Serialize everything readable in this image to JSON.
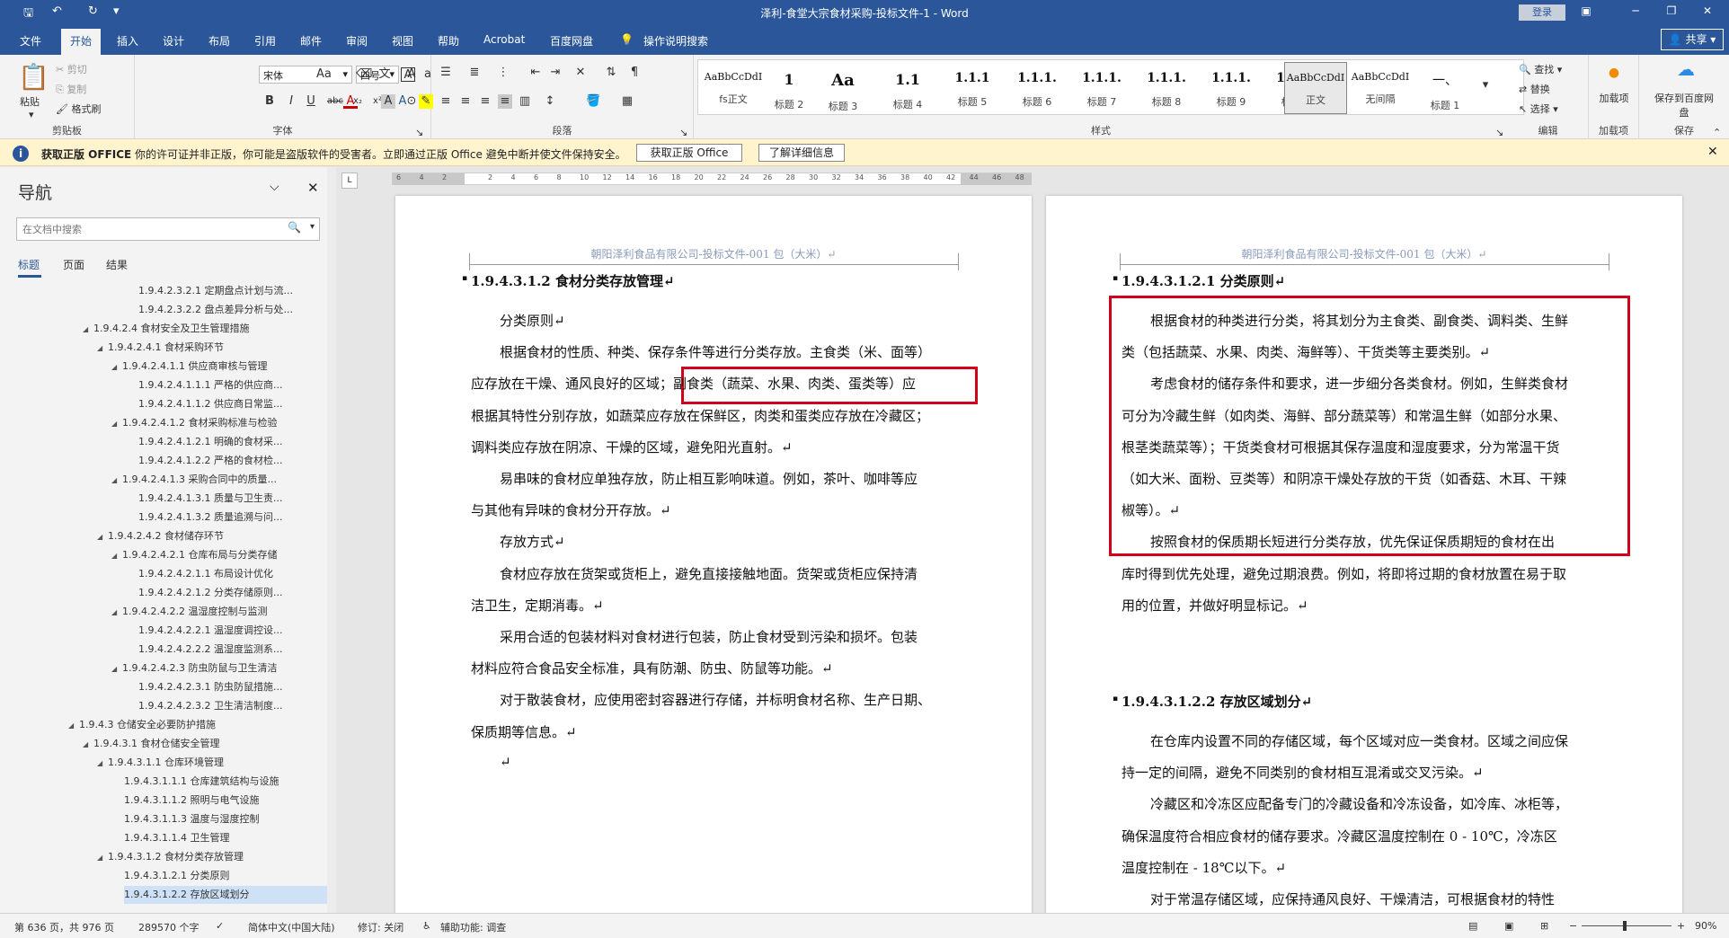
{
  "app": {
    "window_title": "泽利-食堂大宗食材采购-投标文件-1  -  Word",
    "login_label": "登录",
    "share_label": "共享"
  },
  "menu": [
    "文件",
    "开始",
    "插入",
    "设计",
    "布局",
    "引用",
    "邮件",
    "审阅",
    "视图",
    "帮助",
    "Acrobat",
    "百度网盘",
    "操作说明搜索"
  ],
  "ribbon": {
    "clipboard": {
      "label": "剪贴板",
      "paste": "粘贴",
      "cut": "剪切",
      "copy": "复制",
      "painter": "格式刷"
    },
    "font": {
      "label": "字体",
      "family": "宋体",
      "size": "四号"
    },
    "paragraph": {
      "label": "段落"
    },
    "styles": {
      "label": "样式",
      "items": [
        {
          "preview": "AaBbCcDdI",
          "name": "fs正文"
        },
        {
          "preview": "1",
          "name": "标题 2"
        },
        {
          "preview": "Aa",
          "name": "标题 3"
        },
        {
          "preview": "1.1",
          "name": "标题 4"
        },
        {
          "preview": "1.1.1",
          "name": "标题 5"
        },
        {
          "preview": "1.1.1.",
          "name": "标题 6"
        },
        {
          "preview": "1.1.1.",
          "name": "标题 7"
        },
        {
          "preview": "1.1.1.",
          "name": "标题 8"
        },
        {
          "preview": "1.1.1.",
          "name": "标题 9"
        },
        {
          "preview": "1.1.1.",
          "name": "标题 1"
        },
        {
          "preview": "AaBbCcDdI",
          "name": "正文"
        },
        {
          "preview": "AaBbCcDdI",
          "name": "无间隔"
        },
        {
          "preview": "一、",
          "name": "标题 1"
        }
      ]
    },
    "editing": {
      "label": "编辑",
      "find": "查找",
      "replace": "替换",
      "select": "选择"
    },
    "addins": {
      "label": "加载项",
      "load": "加载项"
    },
    "save": {
      "label": "保存",
      "save_to": "保存到百度网盘"
    }
  },
  "message_bar": {
    "title": "获取正版 OFFICE",
    "text": "你的许可证并非正版，你可能是盗版软件的受害者。立即通过正版 Office 避免中断并使文件保持安全。",
    "btn_get": "获取正版 Office",
    "btn_more": "了解详细信息"
  },
  "navigation": {
    "title": "导航",
    "search_placeholder": "在文档中搜索",
    "tabs": [
      "标题",
      "页面",
      "结果"
    ],
    "items": [
      {
        "t": "1.9.4.2.3.2.1 定期盘点计划与流...",
        "lvl": 8,
        "e": false
      },
      {
        "t": "1.9.4.2.3.2.2 盘点差异分析与处...",
        "lvl": 8,
        "e": false
      },
      {
        "t": "1.9.4.2.4 食材安全及卫生管理措施",
        "lvl": 5,
        "e": true
      },
      {
        "t": "1.9.4.2.4.1 食材采购环节",
        "lvl": 6,
        "e": true
      },
      {
        "t": "1.9.4.2.4.1.1 供应商审核与管理",
        "lvl": 7,
        "e": true
      },
      {
        "t": "1.9.4.2.4.1.1.1 严格的供应商...",
        "lvl": 8,
        "e": false
      },
      {
        "t": "1.9.4.2.4.1.1.2 供应商日常监...",
        "lvl": 8,
        "e": false
      },
      {
        "t": "1.9.4.2.4.1.2 食材采购标准与检验",
        "lvl": 7,
        "e": true
      },
      {
        "t": "1.9.4.2.4.1.2.1 明确的食材采...",
        "lvl": 8,
        "e": false
      },
      {
        "t": "1.9.4.2.4.1.2.2 严格的食材检...",
        "lvl": 8,
        "e": false
      },
      {
        "t": "1.9.4.2.4.1.3 采购合同中的质量...",
        "lvl": 7,
        "e": true
      },
      {
        "t": "1.9.4.2.4.1.3.1 质量与卫生责...",
        "lvl": 8,
        "e": false
      },
      {
        "t": "1.9.4.2.4.1.3.2 质量追溯与问...",
        "lvl": 8,
        "e": false
      },
      {
        "t": "1.9.4.2.4.2 食材储存环节",
        "lvl": 6,
        "e": true
      },
      {
        "t": "1.9.4.2.4.2.1 仓库布局与分类存储",
        "lvl": 7,
        "e": true
      },
      {
        "t": "1.9.4.2.4.2.1.1 布局设计优化",
        "lvl": 8,
        "e": false
      },
      {
        "t": "1.9.4.2.4.2.1.2 分类存储原则...",
        "lvl": 8,
        "e": false
      },
      {
        "t": "1.9.4.2.4.2.2 温湿度控制与监测",
        "lvl": 7,
        "e": true
      },
      {
        "t": "1.9.4.2.4.2.2.1 温湿度调控设...",
        "lvl": 8,
        "e": false
      },
      {
        "t": "1.9.4.2.4.2.2.2 温湿度监测系...",
        "lvl": 8,
        "e": false
      },
      {
        "t": "1.9.4.2.4.2.3 防虫防鼠与卫生清洁",
        "lvl": 7,
        "e": true
      },
      {
        "t": "1.9.4.2.4.2.3.1 防虫防鼠措施...",
        "lvl": 8,
        "e": false
      },
      {
        "t": "1.9.4.2.4.2.3.2 卫生清洁制度...",
        "lvl": 8,
        "e": false
      },
      {
        "t": "1.9.4.3 仓储安全必要防护措施",
        "lvl": 4,
        "e": true
      },
      {
        "t": "1.9.4.3.1 食材仓储安全管理",
        "lvl": 5,
        "e": true
      },
      {
        "t": "1.9.4.3.1.1 仓库环境管理",
        "lvl": 6,
        "e": true
      },
      {
        "t": "1.9.4.3.1.1.1 仓库建筑结构与设施",
        "lvl": 7,
        "e": false
      },
      {
        "t": "1.9.4.3.1.1.2 照明与电气设施",
        "lvl": 7,
        "e": false
      },
      {
        "t": "1.9.4.3.1.1.3 温度与湿度控制",
        "lvl": 7,
        "e": false
      },
      {
        "t": "1.9.4.3.1.1.4 卫生管理",
        "lvl": 7,
        "e": false
      },
      {
        "t": "1.9.4.3.1.2 食材分类存放管理",
        "lvl": 6,
        "e": true
      },
      {
        "t": "1.9.4.3.1.2.1 分类原则",
        "lvl": 7,
        "e": false
      },
      {
        "t": "1.9.4.3.1.2.2 存放区域划分",
        "lvl": 7,
        "e": false,
        "sel": true
      }
    ]
  },
  "ruler": {
    "ticks": [
      "6",
      "4",
      "2",
      "",
      "2",
      "4",
      "6",
      "8",
      "10",
      "12",
      "14",
      "16",
      "18",
      "20",
      "22",
      "24",
      "26",
      "28",
      "30",
      "32",
      "34",
      "36",
      "38",
      "40",
      "42",
      "44",
      "46",
      "48"
    ]
  },
  "page_left": {
    "header": "朝阳泽利食品有限公司-投标文件-001 包（大米）↵",
    "heading": "1.9.4.3.1.2 食材分类存放管理↵",
    "lines": [
      "分类原则↵",
      "根据食材的性质、种类、保存条件等进行分类存放。主食类（米、面等）",
      "应存放在干燥、通风良好的区域；副食类（蔬菜、水果、肉类、蛋类等）应",
      "根据其特性分别存放，如蔬菜应存放在保鲜区，肉类和蛋类应存放在冷藏区；",
      "调料类应存放在阴凉、干燥的区域，避免阳光直射。↵",
      "易串味的食材应单独存放，防止相互影响味道。例如，茶叶、咖啡等应",
      "与其他有异味的食材分开存放。↵",
      "存放方式↵",
      "食材应存放在货架或货柜上，避免直接接触地面。货架或货柜应保持清",
      "洁卫生，定期消毒。↵",
      "采用合适的包装材料对食材进行包装，防止食材受到污染和损坏。包装",
      "材料应符合食品安全标准，具有防潮、防虫、防鼠等功能。↵",
      "对于散装食材，应使用密封容器进行存储，并标明食材名称、生产日期、",
      "保质期等信息。↵",
      "↵"
    ]
  },
  "page_right": {
    "header": "朝阳泽利食品有限公司-投标文件-001 包（大米）↵",
    "heading1": "1.9.4.3.1.2.1  分类原则↵",
    "lines1": [
      "根据食材的种类进行分类，将其划分为主食类、副食类、调料类、生鲜",
      "类（包括蔬菜、水果、肉类、海鲜等）、干货类等主要类别。↵",
      "考虑食材的储存条件和要求，进一步细分各类食材。例如，生鲜类食材",
      "可分为冷藏生鲜（如肉类、海鲜、部分蔬菜等）和常温生鲜（如部分水果、",
      "根茎类蔬菜等）；干货类食材可根据其保存温度和湿度要求，分为常温干货",
      "（如大米、面粉、豆类等）和阴凉干燥处存放的干货（如香菇、木耳、干辣",
      "椒等）。↵",
      "按照食材的保质期长短进行分类存放，优先保证保质期短的食材在出",
      "库时得到优先处理，避免过期浪费。例如，将即将过期的食材放置在易于取",
      "用的位置，并做好明显标记。↵"
    ],
    "heading2": "1.9.4.3.1.2.2  存放区域划分↵",
    "lines2": [
      "在仓库内设置不同的存储区域，每个区域对应一类食材。区域之间应保",
      "持一定的间隔，避免不同类别的食材相互混淆或交叉污染。↵",
      "冷藏区和冷冻区应配备专门的冷藏设备和冷冻设备，如冷库、冰柜等，",
      "确保温度符合相应食材的储存要求。冷藏区温度控制在 0 - 10℃，冷冻区",
      "温度控制在 - 18℃以下。↵",
      "对于常温存储区域，应保持通风良好、干燥清洁，可根据食材的特性"
    ]
  },
  "status": {
    "page": "第 636 页，共 976 页",
    "words": "289570 个字",
    "language": "简体中文(中国大陆)",
    "track": "修订: 关闭",
    "accessibility": "辅助功能: 调查",
    "zoom": "90%"
  },
  "colors": {
    "accent": "#2b579a",
    "highlight": "#d0021b",
    "msgbar": "#fff4ce"
  }
}
